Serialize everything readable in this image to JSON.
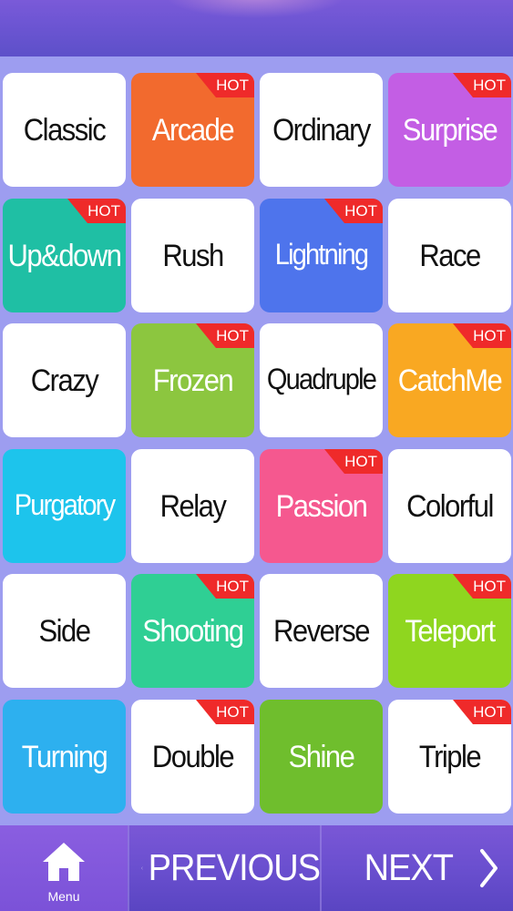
{
  "hot_label": "HOT",
  "tiles": [
    {
      "label": "Classic",
      "bg": "#ffffff",
      "fg": "#111111",
      "hot": false
    },
    {
      "label": "Arcade",
      "bg": "#f26a2e",
      "fg": "#ffffff",
      "hot": true
    },
    {
      "label": "Ordinary",
      "bg": "#ffffff",
      "fg": "#111111",
      "hot": false
    },
    {
      "label": "Surprise",
      "bg": "#c35ee4",
      "fg": "#ffffff",
      "hot": true
    },
    {
      "label": "Up&down",
      "bg": "#1fbfa4",
      "fg": "#ffffff",
      "hot": true
    },
    {
      "label": "Rush",
      "bg": "#ffffff",
      "fg": "#111111",
      "hot": false
    },
    {
      "label": "Lightning",
      "bg": "#4e74ec",
      "fg": "#ffffff",
      "hot": true
    },
    {
      "label": "Race",
      "bg": "#ffffff",
      "fg": "#111111",
      "hot": false
    },
    {
      "label": "Crazy",
      "bg": "#ffffff",
      "fg": "#111111",
      "hot": false
    },
    {
      "label": "Frozen",
      "bg": "#8cc63f",
      "fg": "#ffffff",
      "hot": true
    },
    {
      "label": "Quadruple",
      "bg": "#ffffff",
      "fg": "#111111",
      "hot": false
    },
    {
      "label": "CatchMe",
      "bg": "#f9a822",
      "fg": "#ffffff",
      "hot": true
    },
    {
      "label": "Purgatory",
      "bg": "#1dc4ec",
      "fg": "#ffffff",
      "hot": false
    },
    {
      "label": "Relay",
      "bg": "#ffffff",
      "fg": "#111111",
      "hot": false
    },
    {
      "label": "Passion",
      "bg": "#f5588f",
      "fg": "#ffffff",
      "hot": true
    },
    {
      "label": "Colorful",
      "bg": "#ffffff",
      "fg": "#111111",
      "hot": false
    },
    {
      "label": "Side",
      "bg": "#ffffff",
      "fg": "#111111",
      "hot": false
    },
    {
      "label": "Shooting",
      "bg": "#2fcf94",
      "fg": "#ffffff",
      "hot": true
    },
    {
      "label": "Reverse",
      "bg": "#ffffff",
      "fg": "#111111",
      "hot": false
    },
    {
      "label": "Teleport",
      "bg": "#8fd61f",
      "fg": "#ffffff",
      "hot": true
    },
    {
      "label": "Turning",
      "bg": "#2db0ef",
      "fg": "#ffffff",
      "hot": false
    },
    {
      "label": "Double",
      "bg": "#ffffff",
      "fg": "#111111",
      "hot": true
    },
    {
      "label": "Shine",
      "bg": "#6fbe2d",
      "fg": "#ffffff",
      "hot": false
    },
    {
      "label": "Triple",
      "bg": "#ffffff",
      "fg": "#111111",
      "hot": true
    }
  ],
  "bottom": {
    "menu_label": "Menu",
    "menu_icon": "home-icon",
    "previous_label": "PREVIOUS",
    "next_label": "NEXT"
  }
}
